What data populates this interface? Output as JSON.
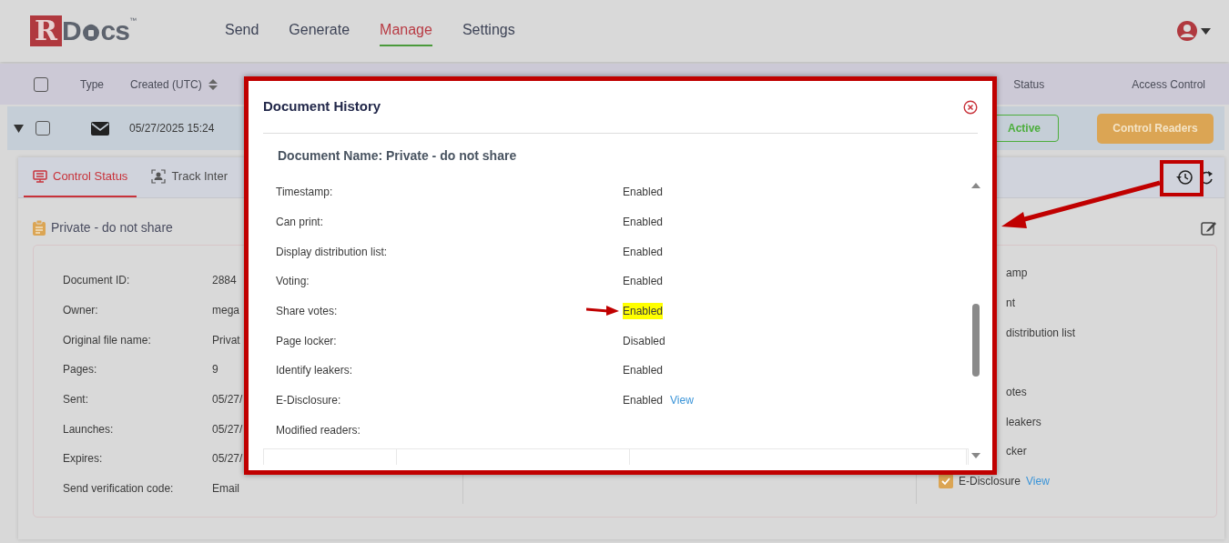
{
  "logo": {
    "letter": "R",
    "text_before": "D",
    "text_after": "cs",
    "mark": "™"
  },
  "nav": [
    {
      "label": "Send",
      "selected": false
    },
    {
      "label": "Generate",
      "selected": false
    },
    {
      "label": "Manage",
      "selected": true
    },
    {
      "label": "Settings",
      "selected": false
    }
  ],
  "table": {
    "columns": [
      "Type",
      "Created (UTC)",
      "Status",
      "Access Control"
    ],
    "select_all_checked": false,
    "rows": [
      {
        "expanded": true,
        "checked": false,
        "created": "05/27/2025 15:24",
        "status": "Active",
        "action": "Control Readers"
      }
    ]
  },
  "panel": {
    "tabs": [
      {
        "label": "Control Status",
        "selected": true
      },
      {
        "label": "Track Inter",
        "selected": false
      }
    ],
    "title": "Private - do not share",
    "details": [
      {
        "label": "Document ID:",
        "value": "2884"
      },
      {
        "label": "Owner:",
        "value": "mega"
      },
      {
        "label": "Original file name:",
        "value": "Privat"
      },
      {
        "label": "Pages:",
        "value": "9"
      },
      {
        "label": "Sent:",
        "value": "05/27/"
      },
      {
        "label": "Launches:",
        "value": "05/27/"
      },
      {
        "label": "Expires:",
        "value": "05/27/"
      },
      {
        "label": "Send verification code:",
        "value": "Email"
      }
    ],
    "options": [
      {
        "label": "amp"
      },
      {
        "label": "nt"
      },
      {
        "label": "distribution list"
      },
      {
        "label": "otes"
      },
      {
        "label": "leakers"
      },
      {
        "label": "cker"
      },
      {
        "label": "E-Disclosure",
        "link": "View",
        "checked": true
      }
    ]
  },
  "dialog": {
    "title": "Document History",
    "document_name": "Document Name: Private - do not share",
    "rows": [
      {
        "label": "Timestamp:",
        "value": "Enabled",
        "highlighted": false
      },
      {
        "label": "Can print:",
        "value": "Enabled",
        "highlighted": false
      },
      {
        "label": "Display distribution list:",
        "value": "Enabled",
        "highlighted": false
      },
      {
        "label": "Voting:",
        "value": "Enabled",
        "highlighted": false
      },
      {
        "label": "Share votes:",
        "value": "Enabled",
        "highlighted": true
      },
      {
        "label": "Page locker:",
        "value": "Disabled",
        "highlighted": false
      },
      {
        "label": "Identify leakers:",
        "value": "Enabled",
        "highlighted": false
      },
      {
        "label": "E-Disclosure:",
        "value": "Enabled",
        "highlighted": false,
        "link": "View"
      },
      {
        "label": "Modified readers:",
        "highlighted": false
      }
    ]
  }
}
